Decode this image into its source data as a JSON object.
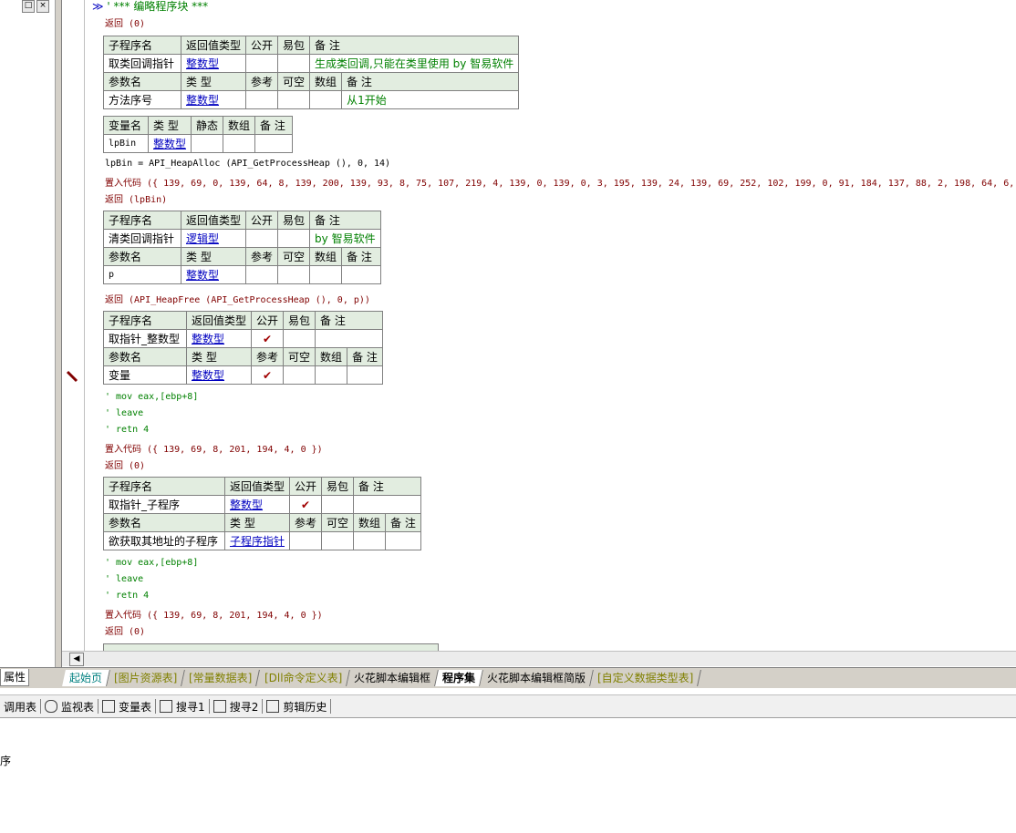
{
  "left_panel": {
    "restore_btn": "□",
    "close_btn": "×"
  },
  "editor": {
    "header_line": "' *** 编略程序块 ***",
    "marker": "≫",
    "lines": {
      "l1": "返回 (0)",
      "lpbin_assign": "lpBin = API_HeapAlloc (API_GetProcessHeap (), 0, 14)",
      "putcode1": "置入代码 ({ 139, 69, 0, 139, 64, 8, 139, 200, 139, 93, 8, 75, 107, 219, 4, 139, 0, 139, 0, 3, 195, 139, 24, 139, 69, 252, 102, 199, 0, 91, 184, 137, 88, 2, 198, 64, 6,",
      "ret_lpbin": "返回 (lpBin)",
      "ret_heapfree": "返回 (API_HeapFree (API_GetProcessHeap (), 0, p))",
      "c_mov1": "' mov eax,[ebp+8]",
      "c_leave1": "' leave",
      "c_retn1": "' retn 4",
      "putcode2": "置入代码 ({ 139, 69, 8, 201, 194, 4, 0 })",
      "ret0_2": "返回 (0)",
      "c_mov2": "' mov eax,[ebp+8]",
      "c_leave2": "' leave",
      "c_retn2": "' retn 4",
      "putcode3": "置入代码 ({ 139, 69, 8, 201, 194, 4, 0 })",
      "ret0_3": "返回 (0)"
    },
    "headers": {
      "sub_name": "子程序名",
      "ret_type": "返回值类型",
      "public": "公开",
      "easy_pkg": "易包",
      "remark": "备 注",
      "param_name": "参数名",
      "type": "类 型",
      "ref": "参考",
      "nullable": "可空",
      "array": "数组",
      "var_name": "变量名",
      "static": "静态"
    },
    "sub1": {
      "name": "取类回调指针",
      "ret": "整数型",
      "remark": "生成类回调,只能在类里使用 by 智易软件",
      "param": "方法序号",
      "param_type": "整数型",
      "param_remark": "从1开始"
    },
    "var1": {
      "name": "lpBin",
      "type": "整数型"
    },
    "sub2": {
      "name": "清类回调指针",
      "ret": "逻辑型",
      "remark": "by 智易软件",
      "param": "p",
      "param_type": "整数型"
    },
    "sub3": {
      "name": "取指针_整数型",
      "ret": "整数型",
      "public_check": "✔",
      "param": "变量",
      "param_type": "整数型",
      "ref_check": "✔"
    },
    "sub4": {
      "name": "取指针_子程序",
      "ret": "整数型",
      "public_check": "✔",
      "param": "欲获取其地址的子程序",
      "param_type": "子程序指针"
    }
  },
  "tabs": {
    "prop": "属性",
    "items": [
      "起始页",
      "[图片资源表]",
      "[常量数据表]",
      "[Dll命令定义表]",
      "火花脚本编辑框",
      "程序集",
      "火花脚本编辑框简版",
      "[自定义数据类型表]"
    ]
  },
  "toolbar": {
    "items": [
      "调用表",
      "监视表",
      "变量表",
      "搜寻1",
      "搜寻2",
      "剪辑历史"
    ]
  },
  "bottom": {
    "text": "序"
  }
}
